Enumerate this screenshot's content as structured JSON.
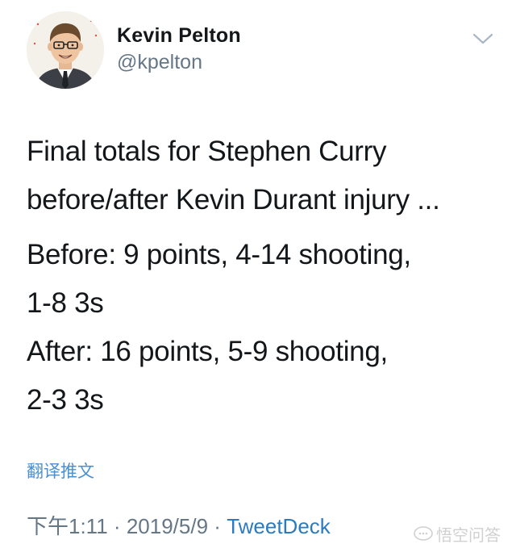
{
  "author": {
    "display_name": "Kevin Pelton",
    "handle": "@kpelton",
    "avatar_icon": "cartoon-portrait-avatar"
  },
  "tweet": {
    "lines": [
      "Final totals for Stephen Curry",
      "before/after Kevin Durant injury ...",
      "Before: 9 points, 4-14 shooting,",
      "1-8 3s",
      "After: 16 points, 5-9 shooting,",
      "2-3 3s"
    ],
    "translate_label": "翻译推文",
    "time": "下午1:11",
    "separator": "·",
    "date": "2019/5/9",
    "source": "TweetDeck"
  },
  "watermark": {
    "text": "悟空问答"
  },
  "colors": {
    "text": "#14171a",
    "secondary": "#657786",
    "link": "#2b7bc0",
    "translate": "#4a8fcf"
  }
}
